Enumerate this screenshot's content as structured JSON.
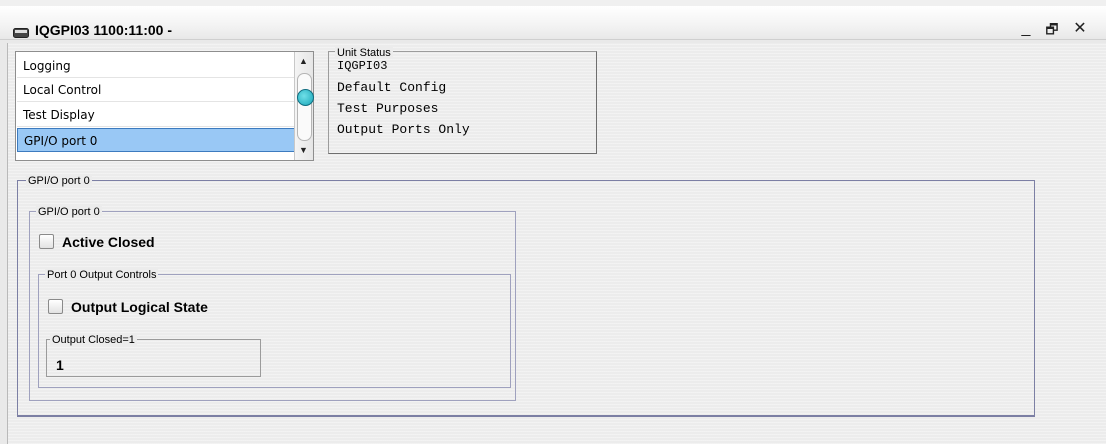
{
  "window": {
    "title": "IQGPI03  1100:11:00  -",
    "controls": {
      "minimize": "_",
      "restore": "🗗",
      "close": "✕"
    }
  },
  "menu_list": {
    "items": [
      {
        "label": "Logging",
        "selected": false
      },
      {
        "label": "Local Control",
        "selected": false
      },
      {
        "label": "Test Display",
        "selected": false
      },
      {
        "label": "GPI/O port 0",
        "selected": true
      }
    ],
    "scroll_up": "▲",
    "scroll_down": "▼"
  },
  "unit_status": {
    "title": "Unit Status",
    "lines": [
      "IQGPI03",
      "Default Config",
      "Test Purposes",
      "Output Ports Only"
    ]
  },
  "port_panel": {
    "title": "GPI/O port 0",
    "group": {
      "title": "GPI/O port 0",
      "active_closed_label": "Active Closed",
      "active_closed_checked": false,
      "output_controls": {
        "title": "Port 0 Output Controls",
        "output_logical_state_label": "Output Logical State",
        "output_logical_state_checked": false,
        "output_closed": {
          "title": "Output Closed=1",
          "value": "1"
        }
      }
    }
  },
  "colors": {
    "selection": "#99c8f5",
    "selection_border": "#3d7bbf",
    "scroll_thumb": "#19a5b8",
    "group_border": "#7c7fa4"
  }
}
